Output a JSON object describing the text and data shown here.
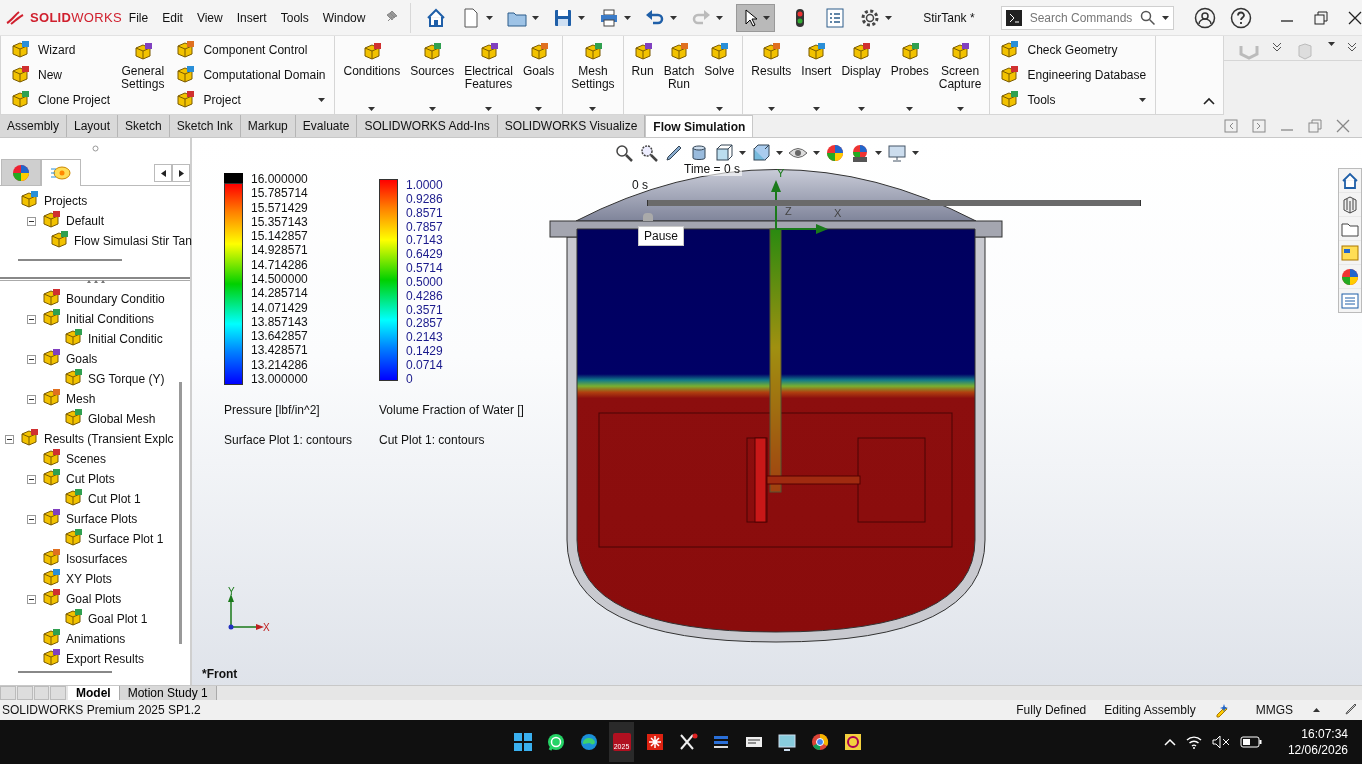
{
  "app": {
    "logo": "**SOLID**WORKS",
    "menu": [
      "File",
      "Edit",
      "View",
      "Insert",
      "Tools",
      "Window"
    ],
    "document_title": "StirTank *",
    "search": {
      "placeholder": "Search Commands"
    }
  },
  "ribbon": {
    "groups": [
      {
        "items": [
          {
            "label": "Wizard",
            "kind": "small",
            "dropdown": false
          },
          {
            "label": "New",
            "kind": "small",
            "dropdown": false
          },
          {
            "label": "Clone Project",
            "kind": "small",
            "dropdown": false
          },
          {
            "label": "General Settings",
            "kind": "large",
            "dropdown": false
          },
          {
            "label": "Component Control",
            "kind": "small",
            "dropdown": false
          },
          {
            "label": "Computational Domain",
            "kind": "small",
            "dropdown": false
          },
          {
            "label": "Project",
            "kind": "small",
            "dropdown": true
          }
        ]
      },
      {
        "items": [
          {
            "label": "Conditions",
            "kind": "large",
            "dropdown": true
          },
          {
            "label": "Sources",
            "kind": "large",
            "dropdown": true
          },
          {
            "label": "Electrical Features",
            "kind": "large",
            "dropdown": true
          },
          {
            "label": "Goals",
            "kind": "large",
            "dropdown": true
          }
        ]
      },
      {
        "items": [
          {
            "label": "Mesh Settings",
            "kind": "large",
            "dropdown": true
          }
        ]
      },
      {
        "items": [
          {
            "label": "Run",
            "kind": "large",
            "dropdown": false
          },
          {
            "label": "Batch Run",
            "kind": "large",
            "dropdown": false
          },
          {
            "label": "Solve",
            "kind": "large",
            "dropdown": true
          }
        ]
      },
      {
        "items": [
          {
            "label": "Results",
            "kind": "large",
            "dropdown": true
          },
          {
            "label": "Insert",
            "kind": "large",
            "dropdown": true
          },
          {
            "label": "Display",
            "kind": "large",
            "dropdown": true
          },
          {
            "label": "Probes",
            "kind": "large",
            "dropdown": true
          },
          {
            "label": "Screen Capture",
            "kind": "large",
            "dropdown": true
          }
        ]
      },
      {
        "items": [
          {
            "label": "Check Geometry",
            "kind": "small",
            "dropdown": false
          },
          {
            "label": "Engineering Database",
            "kind": "small",
            "dropdown": false
          },
          {
            "label": "Tools",
            "kind": "small",
            "dropdown": true
          }
        ]
      }
    ]
  },
  "command_tabs": [
    {
      "label": "Assembly",
      "selected": false
    },
    {
      "label": "Layout",
      "selected": false
    },
    {
      "label": "Sketch",
      "selected": false
    },
    {
      "label": "Sketch Ink",
      "selected": false
    },
    {
      "label": "Markup",
      "selected": false
    },
    {
      "label": "Evaluate",
      "selected": false
    },
    {
      "label": "SOLIDWORKS Add-Ins",
      "selected": false
    },
    {
      "label": "SOLIDWORKS Visualize",
      "selected": false
    },
    {
      "label": "Flow Simulation",
      "selected": true
    }
  ],
  "panel_tabs": [
    {
      "selected": false
    },
    {
      "selected": true
    }
  ],
  "project_tree": [
    {
      "label": "Projects",
      "children": [
        {
          "label": "Default",
          "expanded": true,
          "children": [
            {
              "label": "Flow Simulasi Stir Tan"
            }
          ]
        }
      ]
    }
  ],
  "analysis_tree": [
    {
      "children": [
        {
          "label": "Boundary Conditio"
        },
        {
          "label": "Initial Conditions",
          "expanded": true,
          "children": [
            {
              "label": "Initial Conditic"
            }
          ]
        },
        {
          "label": "Goals",
          "expanded": true,
          "children": [
            {
              "label": "SG Torque (Y)"
            }
          ]
        },
        {
          "label": "Mesh",
          "expanded": true,
          "children": [
            {
              "label": "Global Mesh"
            }
          ]
        }
      ]
    },
    {
      "label": "Results (Transient Explc",
      "expanded": true,
      "children": [
        {
          "label": "Scenes"
        },
        {
          "label": "Cut Plots",
          "expanded": true,
          "children": [
            {
              "label": "Cut Plot 1"
            }
          ]
        },
        {
          "label": "Surface Plots",
          "expanded": true,
          "children": [
            {
              "label": "Surface Plot 1"
            }
          ]
        },
        {
          "label": "Isosurfaces"
        },
        {
          "label": "XY Plots"
        },
        {
          "label": "Goal Plots",
          "expanded": true,
          "children": [
            {
              "label": "Goal Plot 1"
            }
          ]
        },
        {
          "label": "Animations"
        },
        {
          "label": "Export Results"
        }
      ]
    }
  ],
  "legends": [
    {
      "overflow_cap": true,
      "ticks": [
        "16.000000",
        "15.785714",
        "15.571429",
        "15.357143",
        "15.142857",
        "14.928571",
        "14.714286",
        "14.500000",
        "14.285714",
        "14.071429",
        "13.857143",
        "13.642857",
        "13.428571",
        "13.214286",
        "13.000000"
      ],
      "title": "Pressure [lbf/in^2]",
      "subtitle": "Surface Plot 1: contours"
    },
    {
      "ticks": [
        "1.0000",
        "0.9286",
        "0.8571",
        "0.7857",
        "0.7143",
        "0.6429",
        "0.5714",
        "0.5000",
        "0.4286",
        "0.3571",
        "0.2857",
        "0.2143",
        "0.1429",
        "0.0714",
        "0"
      ],
      "title": "Volume Fraction of Water []",
      "subtitle": "Cut Plot 1: contours"
    }
  ],
  "animation": {
    "time_label": "Time = 0 s",
    "start_label": "0 s",
    "level": 0,
    "tooltip": "Pause"
  },
  "model_axes": {
    "y": "Y",
    "z": "Z",
    "x": "X"
  },
  "view_triad": {
    "y": "Y",
    "x": "X"
  },
  "view_name": "*Front",
  "bottom_tabs": [
    {
      "label": "Model",
      "selected": true
    },
    {
      "label": "Motion Study 1",
      "selected": false
    }
  ],
  "status_bar": {
    "product": "SOLIDWORKS Premium 2025 SP1.2",
    "items": [
      "Fully Defined",
      "Editing Assembly"
    ],
    "units": "MMGS"
  },
  "taskbar": {
    "badge": "2025",
    "time": "16:07:34",
    "date": "12/06/2026"
  }
}
